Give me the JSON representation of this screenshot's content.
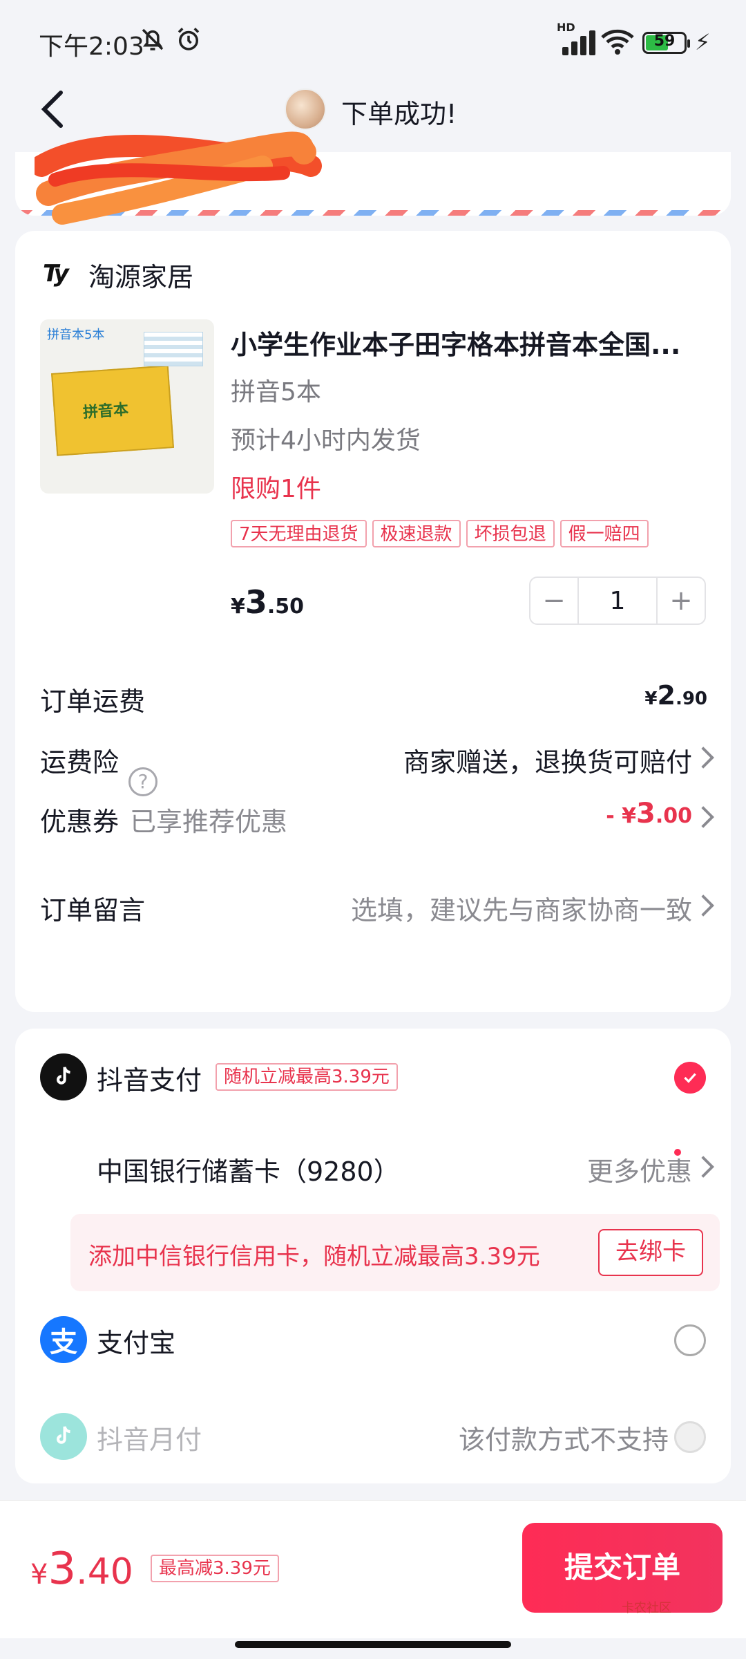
{
  "status_bar": {
    "time": "下午2:03",
    "network": "HD",
    "battery": "59"
  },
  "header": {
    "title": "下单成功!"
  },
  "shop": {
    "logo_text": "Ty",
    "name": "淘源家居"
  },
  "product": {
    "image_label": "拼音本5本",
    "cover_text": "拼音本",
    "title": "小学生作业本子田字格本拼音本全国...",
    "spec": "拼音5本",
    "shipping": "预计4小时内发货",
    "limit": "限购1件",
    "tags": [
      "7天无理由退货",
      "极速退款",
      "坏损包退",
      "假一赔四"
    ],
    "price_currency": "¥",
    "price_int": "3",
    "price_dec": ".50",
    "quantity": "1",
    "qty_minus": "−",
    "qty_plus": "+"
  },
  "rows": {
    "fee_label": "订单运费",
    "fee_currency": "¥",
    "fee_int": "2",
    "fee_dec": ".90",
    "insurance_label": "运费险",
    "insurance_help": "?",
    "insurance_value": "商家赠送，退换货可赔付",
    "coupon_label": "优惠券",
    "coupon_sub": "已享推荐优惠",
    "coupon_prefix": "- ¥",
    "coupon_int": "3",
    "coupon_dec": ".00",
    "note_label": "订单留言",
    "note_placeholder": "选填，建议先与商家协商一致"
  },
  "payment": {
    "douyin_label": "抖音支付",
    "douyin_promo": "随机立减最高3.39元",
    "card_label": "中国银行储蓄卡（9280）",
    "more_offers": "更多优惠",
    "bind_text": "添加中信银行信用卡，随机立减最高3.39元",
    "bind_button": "去绑卡",
    "alipay_label": "支付宝",
    "alipay_logo": "支",
    "monthly_label": "抖音月付",
    "monthly_note": "该付款方式不支持"
  },
  "bottom": {
    "total_currency": "¥",
    "total_int": "3",
    "total_dec": ".40",
    "save_tag": "最高减3.39元",
    "submit": "提交订单",
    "watermark": "卡农社区"
  },
  "colors": {
    "accent": "#fe2c55",
    "promo_red": "#e8334d",
    "page_bg": "#f3f4f8"
  }
}
